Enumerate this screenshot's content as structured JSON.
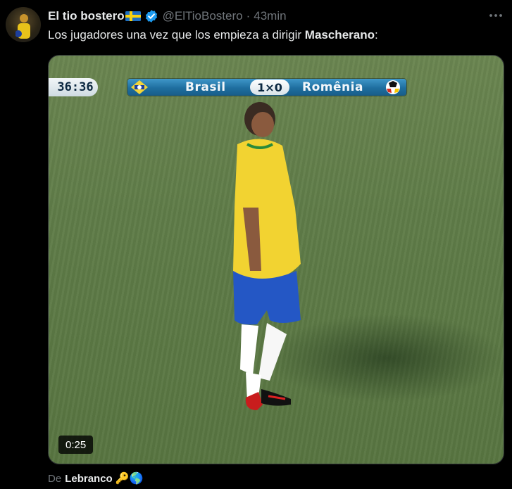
{
  "author": {
    "display_name": "El tio bostero",
    "handle": "@ElTioBostero",
    "separator": "·",
    "time": "43min",
    "flag_icon": "sweden-flag-icon",
    "verified_icon": "verified-badge-icon"
  },
  "tweet": {
    "text_prefix": "Los jugadores una vez que los empieza a dirigir ",
    "text_bold": "Mascherano",
    "text_suffix": ":"
  },
  "video": {
    "scoreboard": {
      "clock": "36:36",
      "home_team": "Brasil",
      "score": "1×0",
      "away_team": "Romênia"
    },
    "duration": "0:25"
  },
  "attribution": {
    "prefix": "De",
    "author": "Lebranco",
    "emojis": "🔑🌎"
  },
  "colors": {
    "background": "#000000",
    "primary_text": "#e7e9ea",
    "secondary_text": "#71767b",
    "verified_blue": "#1d9bf0",
    "scoreboard_blue": "#1e6e9f",
    "jersey_yellow": "#f2d331",
    "shorts_blue": "#2457c5"
  }
}
